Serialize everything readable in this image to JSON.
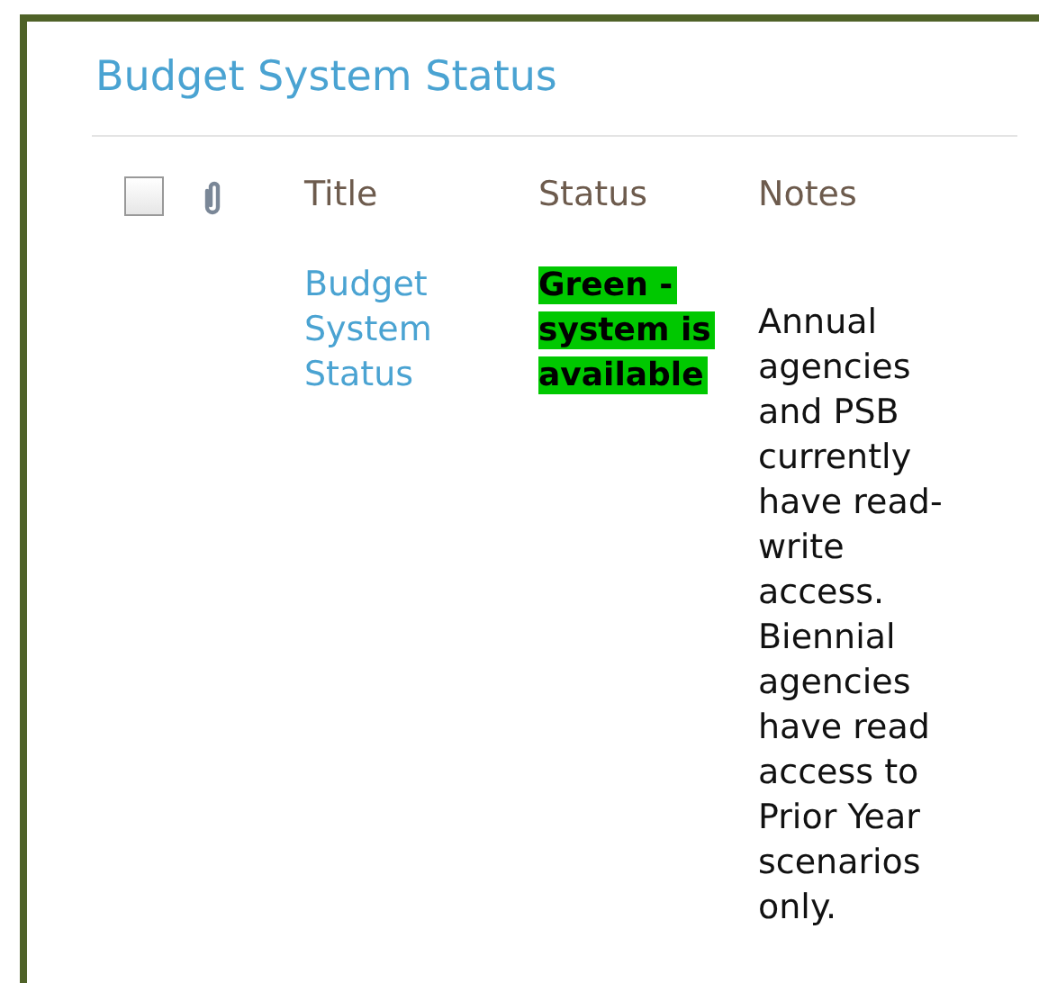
{
  "title": "Budget System Status",
  "table": {
    "select_all": {
      "checked": false
    },
    "columns": [
      "Title",
      "Status",
      "Notes"
    ],
    "rows": [
      {
        "title": "Budget System Status",
        "status": "Green - system is available",
        "notes": "Annual agencies and PSB currently have read-write access. Biennial agencies have read access to Prior Year scenarios only."
      }
    ]
  }
}
